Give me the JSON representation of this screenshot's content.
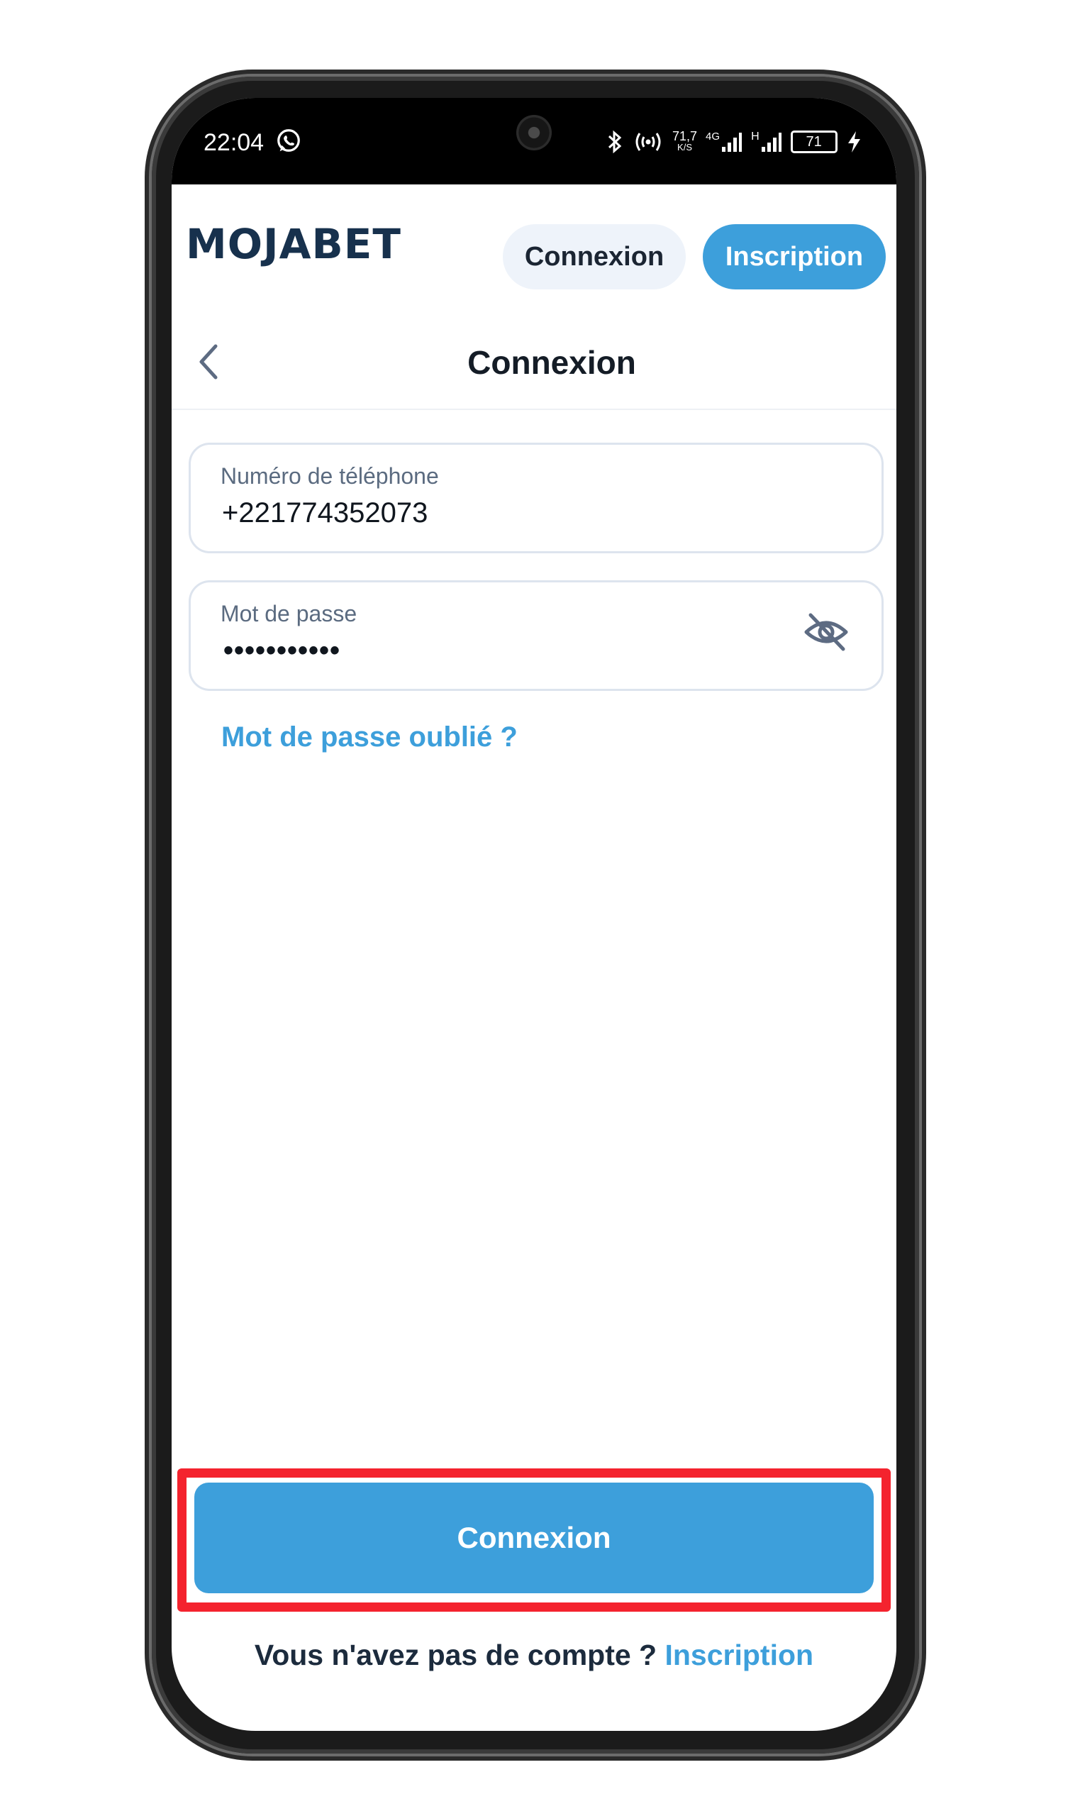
{
  "status_bar": {
    "time": "22:04",
    "net_speed_value": "71,7",
    "net_speed_unit": "K/S",
    "network_4g": "4G",
    "network_h": "H",
    "battery": "71"
  },
  "header": {
    "logo": "MOJABET",
    "login_label": "Connexion",
    "signup_label": "Inscription"
  },
  "page": {
    "title": "Connexion"
  },
  "form": {
    "phone_label": "Numéro de téléphone",
    "phone_value": "+221774352073",
    "password_label": "Mot de passe",
    "password_value": "•••••••••••",
    "forgot_link": "Mot de passe oublié ?"
  },
  "submit": {
    "label": "Connexion"
  },
  "footer": {
    "question": "Vous n'avez pas de compte ? ",
    "signup_link": "Inscription"
  },
  "colors": {
    "accent": "#3d9fdb",
    "highlight": "#f4232e",
    "text_dark": "#17314d"
  }
}
